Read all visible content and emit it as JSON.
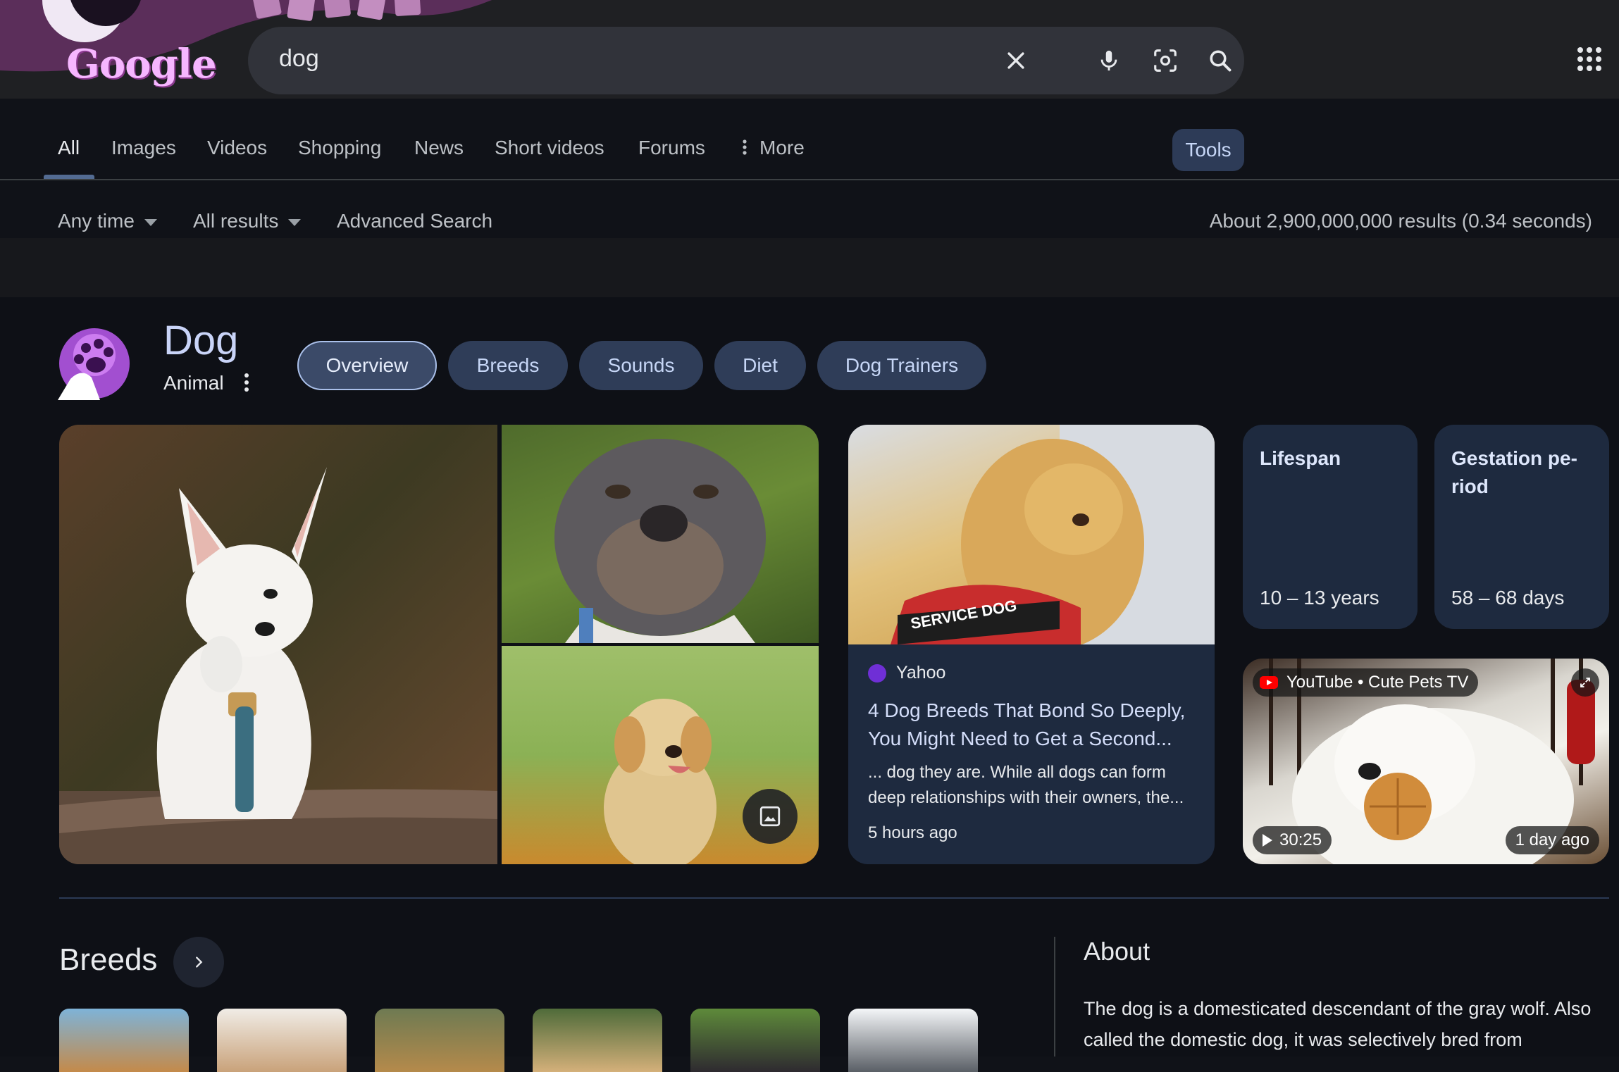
{
  "header": {
    "logo_text": "Google",
    "search_value": "dog",
    "icons": [
      "close-icon",
      "mic-icon",
      "lens-icon",
      "search-icon",
      "apps-icon"
    ]
  },
  "tabs": [
    {
      "label": "All",
      "active": true
    },
    {
      "label": "Images"
    },
    {
      "label": "Videos"
    },
    {
      "label": "Shopping"
    },
    {
      "label": "News"
    },
    {
      "label": "Short videos"
    },
    {
      "label": "Forums"
    },
    {
      "label": "More"
    }
  ],
  "tools_label": "Tools",
  "filters": {
    "time": "Any time",
    "results": "All results",
    "advanced": "Advanced Search",
    "stats": "About 2,900,000,000 results (0.34 seconds)"
  },
  "entity": {
    "title": "Dog",
    "subtitle": "Animal",
    "chips": [
      "Overview",
      "Breeds",
      "Sounds",
      "Diet",
      "Dog Trainers"
    ],
    "selected_chip": "Overview"
  },
  "news_card": {
    "source": "Yahoo",
    "source_logo_text": "yahoo!",
    "title": "4 Dog Breeds That Bond So Deeply, You Might Need to Get a Second...",
    "snippet": "... dog they are. While all dogs can form deep relationships with their owners, the...",
    "time": "5 hours ago",
    "image_badge": "SERVICE DOG"
  },
  "facts": [
    {
      "label": "Lifespan",
      "value": "10 – 13 years"
    },
    {
      "label": "Gestation pe-riod",
      "value": "58 – 68 days"
    }
  ],
  "video": {
    "source": "YouTube • Cute Pets TV",
    "duration": "30:25",
    "age": "1 day ago"
  },
  "breeds": {
    "title": "Breeds"
  },
  "about": {
    "title": "About",
    "text": "The dog is a domesticated descendant of the gray wolf. Also called the domestic dog, it was selectively bred from"
  },
  "colors": {
    "accent": "#8ab4f8",
    "chip_bg": "#2f3d58",
    "card_bg": "#1e2a3f",
    "page_bg": "#101218"
  }
}
